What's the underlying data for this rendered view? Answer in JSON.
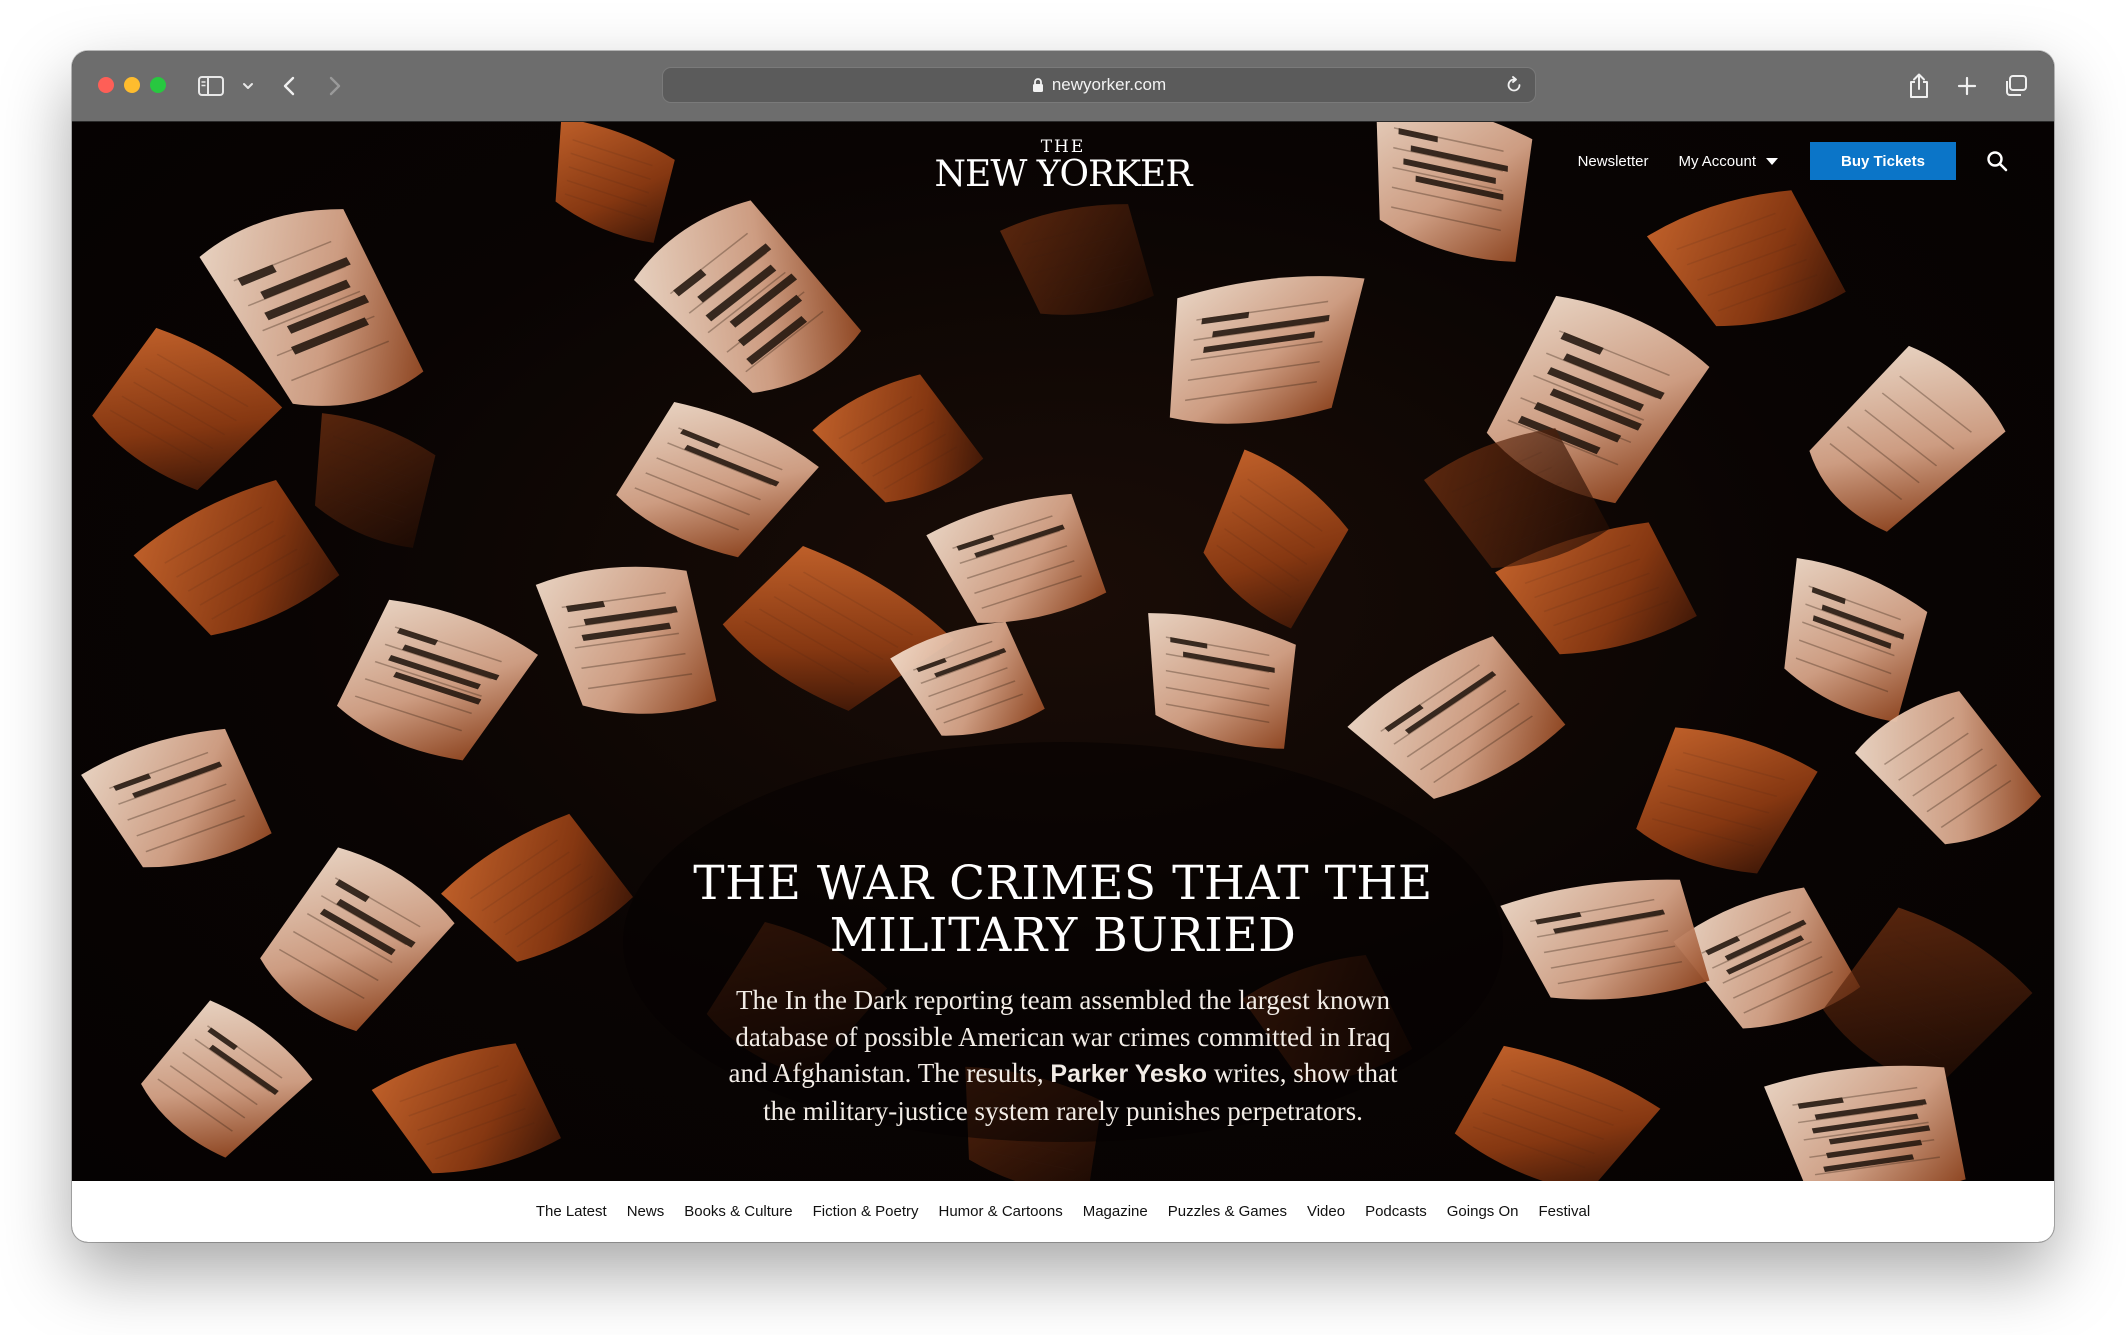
{
  "browser": {
    "url": "newyorker.com"
  },
  "site": {
    "logo_the": "THE",
    "logo_main": "NEW YORKER"
  },
  "header": {
    "newsletter": "Newsletter",
    "account": "My Account",
    "buy_tickets": "Buy Tickets"
  },
  "hero": {
    "headline": "The War Crimes That the Military Buried",
    "dek_part1": "The In the Dark reporting team assembled the largest known database of possible American war crimes committed in Iraq and Afghanistan. The results,",
    "dek_author": "Parker Yesko",
    "dek_part2": "writes, show that the military-justice system rarely punishes perpetrators."
  },
  "section_nav": [
    "The Latest",
    "News",
    "Books & Culture",
    "Fiction & Poetry",
    "Humor & Cartoons",
    "Magazine",
    "Puzzles & Games",
    "Video",
    "Podcasts",
    "Goings On",
    "Festival"
  ],
  "colors": {
    "accent_button": "#0b75c8",
    "titlebar": "#6d6d6d",
    "paper_light": "#e8cdbb",
    "paper_orange": "#b3541e"
  }
}
